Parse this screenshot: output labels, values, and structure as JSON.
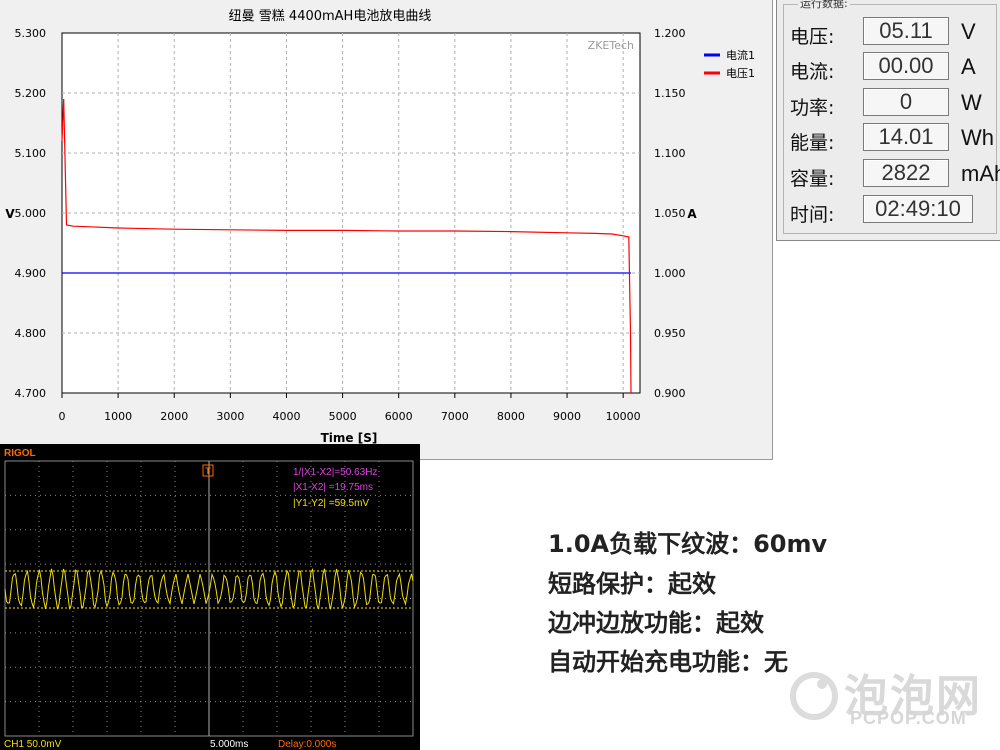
{
  "chart": {
    "title": "纽曼 雪糕 4400mAH电池放电曲线",
    "watermark": "ZKETech"
  },
  "chart_data": {
    "type": "line",
    "title": "纽曼 雪糕 4400mAH电池放电曲线",
    "xlabel": "Time [S]",
    "ylabel": "V",
    "y2label": "A",
    "xlim": [
      0,
      10300
    ],
    "ylim": [
      4.7,
      5.3
    ],
    "y2lim": [
      0.9,
      1.2
    ],
    "x_ticks": [
      "0",
      "1000",
      "2000",
      "3000",
      "4000",
      "5000",
      "6000",
      "7000",
      "8000",
      "9000",
      "10000"
    ],
    "y_ticks": [
      "5.300",
      "5.200",
      "5.100",
      "5.000",
      "4.900",
      "4.800",
      "4.700"
    ],
    "y2_ticks": [
      "1.200",
      "1.150",
      "1.100",
      "1.050",
      "1.000",
      "0.950",
      "0.900"
    ],
    "legend_position": "right",
    "series": [
      {
        "name": "电流1",
        "axis": "right",
        "color": "#0000ff",
        "x": [
          0,
          10140
        ],
        "values": [
          1.0,
          1.0
        ]
      },
      {
        "name": "电压1",
        "axis": "left",
        "color": "#ff0000",
        "x": [
          0,
          30,
          80,
          200,
          500,
          1000,
          2000,
          3000,
          4000,
          5000,
          6000,
          7000,
          8000,
          9000,
          9500,
          9800,
          10000,
          10100,
          10130,
          10140
        ],
        "values": [
          5.12,
          5.19,
          4.98,
          4.978,
          4.977,
          4.975,
          4.973,
          4.972,
          4.971,
          4.971,
          4.97,
          4.97,
          4.969,
          4.967,
          4.966,
          4.965,
          4.962,
          4.96,
          4.8,
          4.7
        ]
      }
    ]
  },
  "readout": {
    "group_title": "运行数据:",
    "rows": [
      {
        "label": "电压:",
        "value": "05.11",
        "unit": "V"
      },
      {
        "label": "电流:",
        "value": "00.00",
        "unit": "A"
      },
      {
        "label": "功率:",
        "value": "0",
        "unit": "W"
      },
      {
        "label": "能量:",
        "value": "14.01",
        "unit": "Wh"
      },
      {
        "label": "容量:",
        "value": "2822",
        "unit": "mAh"
      },
      {
        "label": "时间:",
        "value": "02:49:10",
        "unit": ""
      }
    ]
  },
  "scope": {
    "brand": "RIGOL",
    "trigger_marker": "T",
    "measure_freq": "1/|X1-X2|=50.63Hz",
    "measure_dx": "|X1-X2|  =19.75ms",
    "measure_dy": "|Y1-Y2|  =59.5mV",
    "channel": "CH1  50.0mV",
    "timebase": "5.000ms",
    "delay": "Delay:0.000s",
    "colors": {
      "brand": "#ff6a00",
      "cursor": "#e040e0",
      "trace": "#f0e000",
      "grid": "#8a8a8a"
    }
  },
  "specs": [
    "1.0A负载下纹波：60mv",
    "短路保护：起效",
    "边冲边放功能：起效",
    "自动开始充电功能：无"
  ],
  "watermark": {
    "main": "泡泡网",
    "sub": "PCPOP.COM"
  }
}
